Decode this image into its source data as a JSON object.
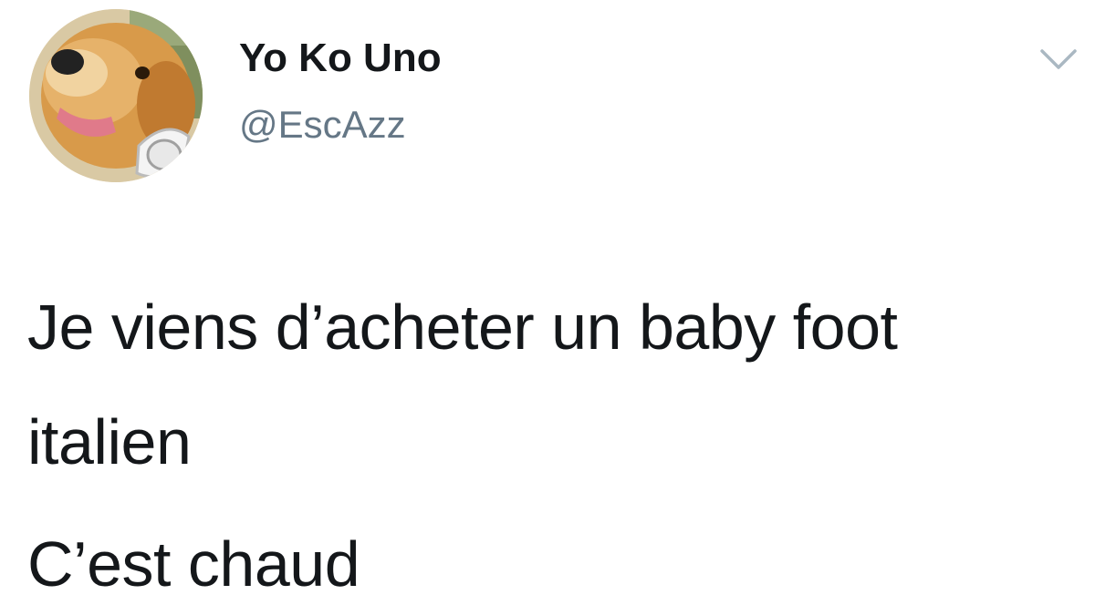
{
  "tweet": {
    "author": {
      "display_name": "Yo Ko Uno",
      "handle": "@EscAzz",
      "avatar_icon": "dog-with-headphones-avatar"
    },
    "menu_icon": "chevron-down-icon",
    "text_lines": [
      "Je viens d’acheter un baby foot",
      "italien",
      "C’est chaud"
    ]
  },
  "colors": {
    "background": "#ffffff",
    "primary_text": "#14171a",
    "secondary_text": "#657786",
    "chevron": "#aab8c2"
  }
}
